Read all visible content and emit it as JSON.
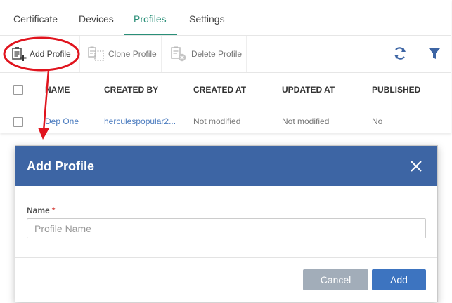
{
  "tabs": [
    {
      "label": "Certificate",
      "active": false
    },
    {
      "label": "Devices",
      "active": false
    },
    {
      "label": "Profiles",
      "active": true
    },
    {
      "label": "Settings",
      "active": false
    }
  ],
  "toolbar": {
    "add_profile": "Add Profile",
    "clone_profile": "Clone Profile",
    "delete_profile": "Delete Profile",
    "refresh_icon": "refresh-icon",
    "filter_icon": "filter-icon"
  },
  "table": {
    "columns": [
      "NAME",
      "CREATED BY",
      "CREATED AT",
      "UPDATED AT",
      "PUBLISHED"
    ],
    "rows": [
      {
        "name": "Dep One",
        "created_by": "herculespopular2...",
        "created_at": "Not modified",
        "updated_at": "Not modified",
        "published": "No"
      }
    ]
  },
  "dialog": {
    "title": "Add Profile",
    "name_label": "Name",
    "required_mark": "*",
    "name_placeholder": "Profile Name",
    "name_value": "",
    "cancel_label": "Cancel",
    "add_label": "Add"
  },
  "colors": {
    "accent_tab": "#2a8f78",
    "header_bg": "#3d65a4",
    "primary_button": "#3d74c0",
    "secondary_button": "#a2adb9",
    "annotation": "#e0141e",
    "link": "#4a7bbf"
  }
}
